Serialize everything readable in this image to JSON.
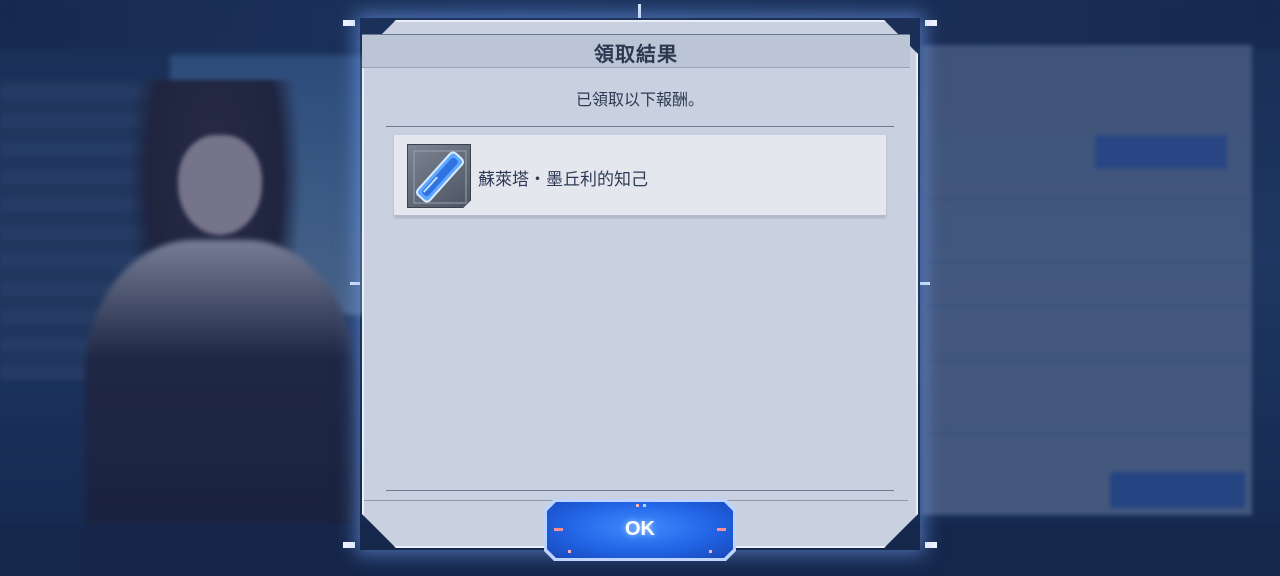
{
  "dialog": {
    "title": "領取結果",
    "subtitle": "已領取以下報酬。"
  },
  "rewards": [
    {
      "name": "蘇萊塔・墨丘利的知己",
      "icon": "blue-card-item-icon"
    }
  ],
  "ok_button": {
    "label": "OK"
  },
  "colors": {
    "accent": "#2264e6",
    "panel": "#c9d1e0",
    "title_text": "#2d3850"
  }
}
